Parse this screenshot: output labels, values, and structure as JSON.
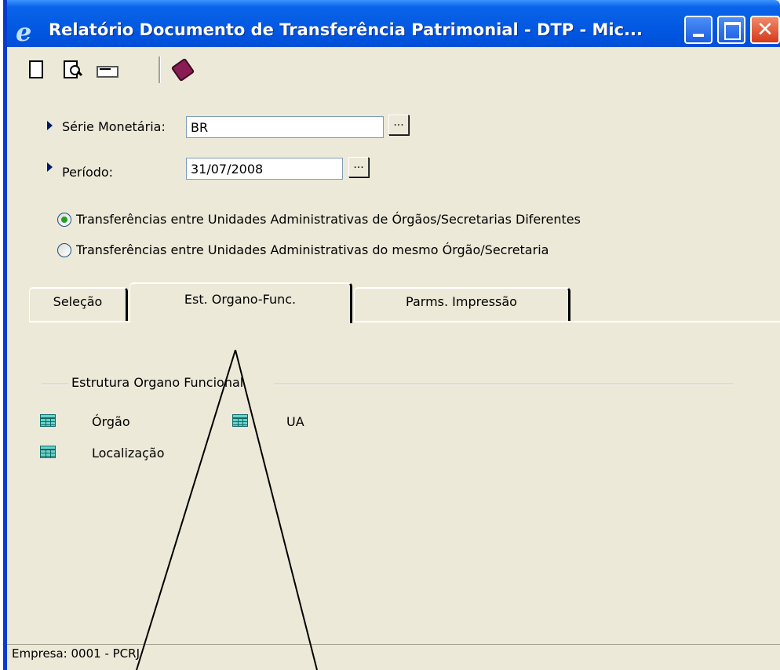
{
  "window": {
    "title": "Relatório Documento de Transferência Patrimonial - DTP - Mic...",
    "icon": "ie-icon",
    "minimize_glyph": "",
    "maximize_glyph": "",
    "close_glyph": "✕"
  },
  "toolbar": {
    "items": [
      "new-document-icon",
      "print-preview-icon",
      "print-icon",
      "help-book-icon"
    ]
  },
  "form": {
    "serie_label": "Série Monetária:",
    "serie_value": "BR",
    "periodo_label": "Período:",
    "periodo_value": "31/07/2008",
    "browse_label": "..."
  },
  "options": [
    {
      "label": "Transferências entre Unidades Administrativas de Órgãos/Secretarias Diferentes",
      "selected": true
    },
    {
      "label": "Transferências entre Unidades Administrativas do mesmo Órgão/Secretaria",
      "selected": false
    }
  ],
  "tabs": [
    {
      "label": "Seleção",
      "active": false
    },
    {
      "label": "Est. Organo-Func.",
      "active": true
    },
    {
      "label": "Parms. Impressão",
      "active": false
    }
  ],
  "group": {
    "title": "Estrutura Organo Funcional",
    "items": [
      {
        "label": "Órgão",
        "icon": "table-icon"
      },
      {
        "label": "UA",
        "icon": "table-icon"
      },
      {
        "label": "Localização",
        "icon": "table-icon"
      }
    ]
  },
  "status": {
    "text": "Empresa: 0001 - PCRJ"
  },
  "colors": {
    "titlebar": "#0055e0",
    "face": "#ece9d8",
    "radio_checked": "#21a121",
    "table_icon": "#6ed0c6"
  }
}
